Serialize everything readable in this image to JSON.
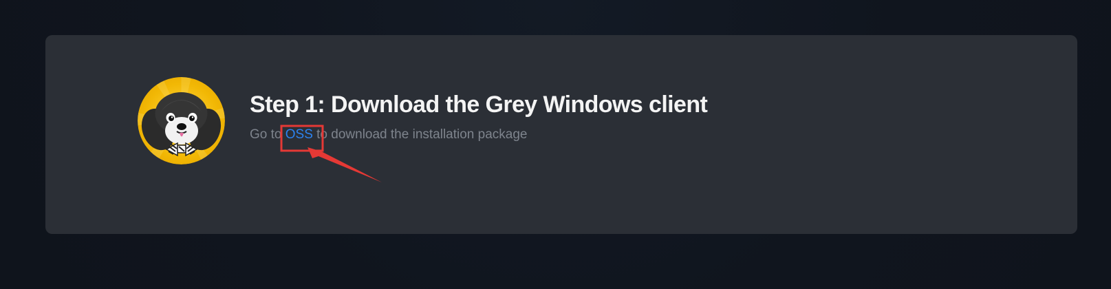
{
  "step": {
    "title": "Step 1: Download the Grey Windows client",
    "description_prefix": "Go to ",
    "link_label": "OSS",
    "description_suffix": " to download the installation package"
  },
  "colors": {
    "page_background": "#111722",
    "card_background": "#2b2f36",
    "title": "#f4f4f4",
    "description": "#7e848d",
    "link": "#2c83f0",
    "annotation": "#e53935",
    "avatar_background": "#f2b805"
  },
  "icons": {
    "avatar": "dog-avatar-icon",
    "annotation": "arrow-annotation-icon"
  }
}
